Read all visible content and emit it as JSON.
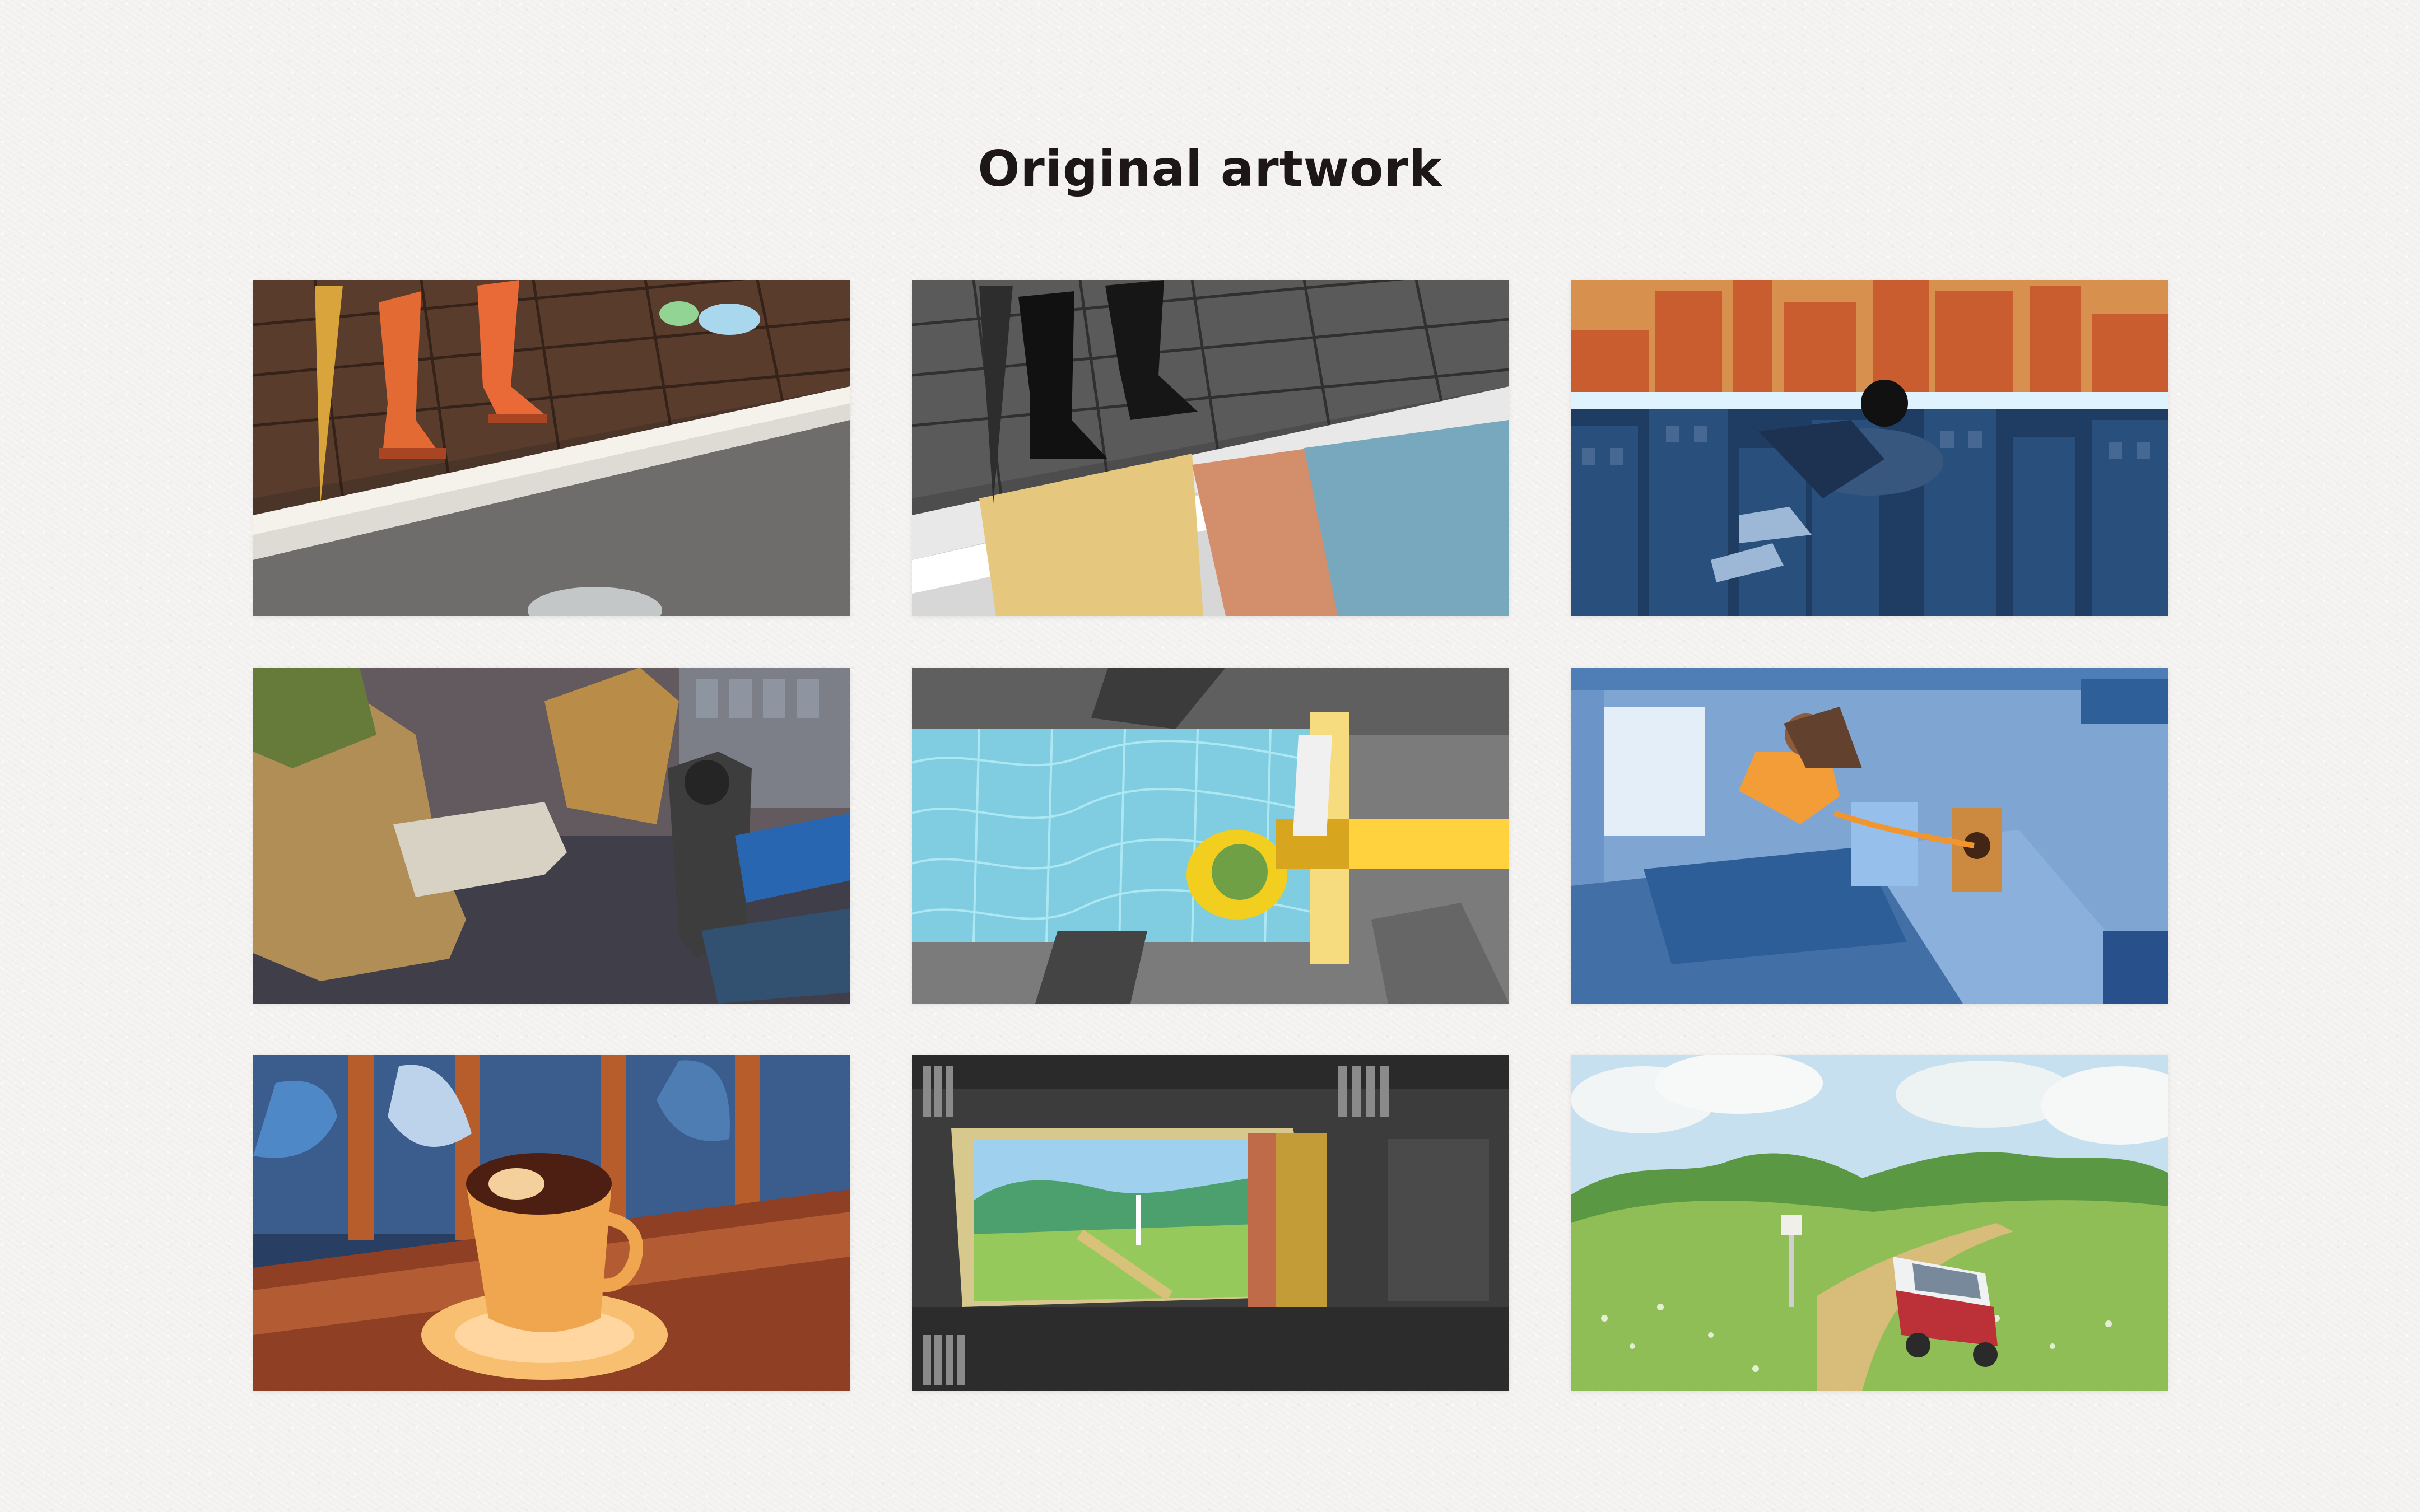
{
  "page": {
    "title": "Original artwork"
  },
  "artworks": [
    {
      "slot": "artwork-1"
    },
    {
      "slot": "artwork-2"
    },
    {
      "slot": "artwork-3"
    },
    {
      "slot": "artwork-4"
    },
    {
      "slot": "artwork-5"
    },
    {
      "slot": "artwork-6"
    },
    {
      "slot": "artwork-7"
    },
    {
      "slot": "artwork-8"
    },
    {
      "slot": "artwork-9"
    }
  ],
  "colors": {
    "background": "#f4f3f1",
    "title": "#1d1717",
    "accent_orange": "#e36a32",
    "accent_yellow": "#e8bc3b",
    "accent_blue": "#3d6f9e",
    "accent_green": "#7bb044"
  }
}
